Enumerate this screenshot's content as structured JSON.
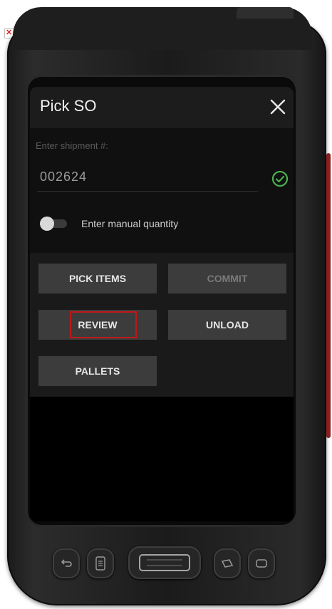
{
  "app": {
    "title": "Pick SO"
  },
  "form": {
    "shipment_label": "Enter shipment #:",
    "shipment_value": "002624",
    "manual_quantity_label": "Enter manual quantity",
    "manual_quantity_enabled": false
  },
  "buttons": {
    "pick_items": "PICK ITEMS",
    "commit": "COMMIT",
    "review": "REVIEW",
    "unload": "UNLOAD",
    "pallets": "PALLETS"
  },
  "colors": {
    "screen_bg": "#000000",
    "button_bg": "#3c3c3c",
    "valid_green": "#4caf50",
    "highlight_red": "#c01818"
  },
  "icons": {
    "close": "close-icon",
    "valid": "check-circle-icon",
    "broken_image": "broken-image-icon"
  }
}
